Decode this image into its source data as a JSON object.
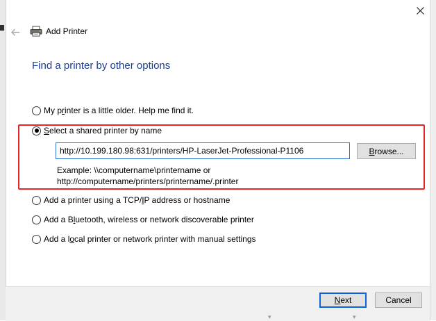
{
  "window": {
    "title": "Add Printer",
    "close_icon": "close-icon",
    "back_icon": "back-arrow-icon",
    "app_icon": "printer-icon"
  },
  "page": {
    "heading": "Find a printer by other options"
  },
  "options": [
    {
      "pre": "My p",
      "key": "r",
      "post": "inter is a little older. Help me find it.",
      "checked": false
    },
    {
      "pre": "",
      "key": "S",
      "post": "elect a shared printer by name",
      "checked": true
    },
    {
      "pre": "Add a printer using a TCP/",
      "key": "I",
      "post": "P address or hostname",
      "checked": false
    },
    {
      "pre": "Add a B",
      "key": "l",
      "post": "uetooth, wireless or network discoverable printer",
      "checked": false
    },
    {
      "pre": "Add a l",
      "key": "o",
      "post": "cal printer or network printer with manual settings",
      "checked": false
    }
  ],
  "shared_printer": {
    "value": "http://10.199.180.98:631/printers/HP-LaserJet-Professional-P1106",
    "browse_pre": "",
    "browse_key": "B",
    "browse_post": "rowse...",
    "example_line1": "Example: \\\\computername\\printername or",
    "example_line2": "http://computername/printers/printername/.printer"
  },
  "footer": {
    "next_pre": "",
    "next_key": "N",
    "next_post": "ext",
    "cancel_label": "Cancel"
  },
  "colors": {
    "heading": "#1c3c8f",
    "highlight": "#e8262a",
    "focus": "#0a64d8"
  }
}
